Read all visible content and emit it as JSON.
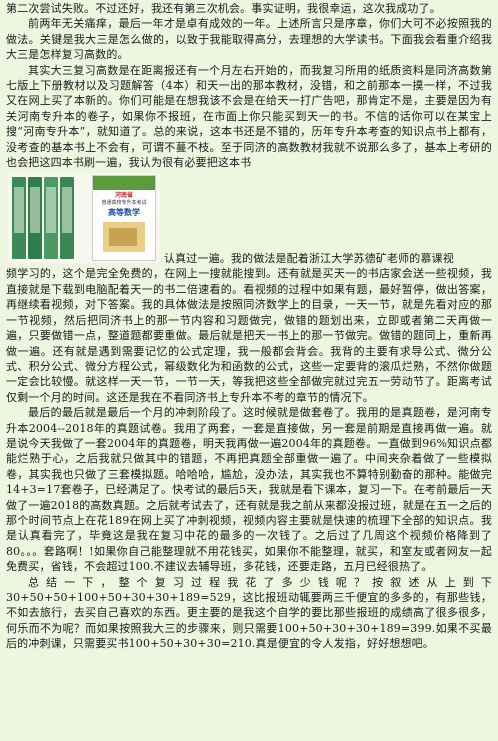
{
  "paragraphs_top": [
    "第二次尝试失败。不过还好，我还有第三次机会。事实证明，我很幸运，这次我成功了。",
    "前两年无关痛痒，最后一年才是卓有成效的一年。上述所言只是序章，你们大可不必按照我的做法。关键是我大三是怎么做的，以致于我能取得高分，去理想的大学读书。下面我会看重介绍我大三是怎样复习高数的。",
    "其实大三复习高数是在距离报还有一个月左右开始的，而我复习所用的纸质资料是同济高数第七版上下册教材以及习题解答（4本）和天一出的那本教材，没错，和之前那本一摸一样，不过我又在网上买了本新的。你们可能是在想我该不会是在给天一打广告吧，那肯定不是，主要是因为有关河南专升本的卷子，如果你不报班，在市面上你只能买到天一的书。不信的话你可以在某宝上搜“河南专升本”，就知道了。总的来说，这本书还是不错的，历年专升本考查的知识点书上都有，没考查的基本书上不会有，可谓不蔓不枝。至于同济的高数教材我就不说那么多了，基本上考研的也会把这四本书刷一遍，我认为很有必要把这本书"
  ],
  "image_caption_line": "认真过一遍。我的做法是配着浙江大学苏德矿老师的慕课视",
  "book_cover": {
    "province": "河南省",
    "subtitle": "普通高校专升本考试",
    "title": "高等数学"
  },
  "paragraphs_bottom": [
    "频学习的，这个是完全免费的，在网上一搜就能搜到。还有就是买天一的书店家会送一些视频，我直接就是下载到电脑配着天一的书二倍速看的。看视频的过程中如果有题，最好暂停，做出答案，再继续看视频，对下答案。我的具体做法是按照同济数学上的目录，一天一节，就是先看对应的那一节视频，然后把同济书上的那一节内容和习题做完，做错的题划出来，立即或者第二天再做一遍，只要做错一点，整道题都要重做。最后就是把天一书上的那一节做完。做错的题同上，重新再做一遍。还有就是遇到需要记忆的公式定理，我一般都会背会。我背的主要有求导公式、微分公式、积分公式、微分方程公式，幂级数化为和函数的公式，这些一定要背的滚瓜烂熟，不然你做题一定会比较慢。就这样一天一节，一节一天，等我把这些全部做完就过完五一劳动节了。距离考试仅剩一个月的时间。这还是我在不看同济书上专升本不考的章节的情况下。",
    "最后的最后就是最后一个月的冲刺阶段了。这时候就是做套卷了。我用的是真题卷，是河南专升本2004--2018年的真题试卷。我用了两套，一套是直接做，另一套是前期是直接再做一遍。就是说今天我做了一套2004年的真题卷，明天我再做一遍2004年的真题卷。一直做到96%知识点都能烂熟于心，之后我就只做其中的错题，不再把真题全部重做一遍了。中间夹杂着做了一些模拟卷，其实我也只做了三套模拟题。哈哈哈，尴尬，没办法，其实我也不算特别勤奋的那种。能做完14+3=17套卷子，已经满足了。快考试的最后5天，我就是看下课本，复习一下。在考前最后一天做了一遍2018的高数真题。之后就考试去了，还有就是我之前从来都没报过班，就是在五一之后的那个时间节点上在花189在网上买了冲刺视频，视频内容主要就是快速的梳理下全部的知识点。我是认真看完了，毕竟这是我在复习中花的最多的一次钱了。之后过了几周这个视频价格降到了80。。。套路啊！!如果你自己能整理就不用花钱买，如果你不能整理，就买，和室友或者网友一起免费买，省钱，不会超过100.不建议去辅导班，多花钱，还要走路，五月已经很热了。",
    "总结一下，整个复习过程我花了多少钱呢？按叙述从上到下30+50+50+100+50+30+30+189=529，这比报班动辄要两三千便宜的多多的，有那些钱，不如去旅行，去买自己喜欢的东西。更主要的是我这个自学的要比那些报班的成绩高了很多很多，何乐而不为呢？而如果按照我大三的步骤来，则只需要100+50+30+30+189=399.如果不买最后的冲刺课，只需要买书100+50+30+30=210.真是便宜的令人发指，好好想想吧。"
  ]
}
